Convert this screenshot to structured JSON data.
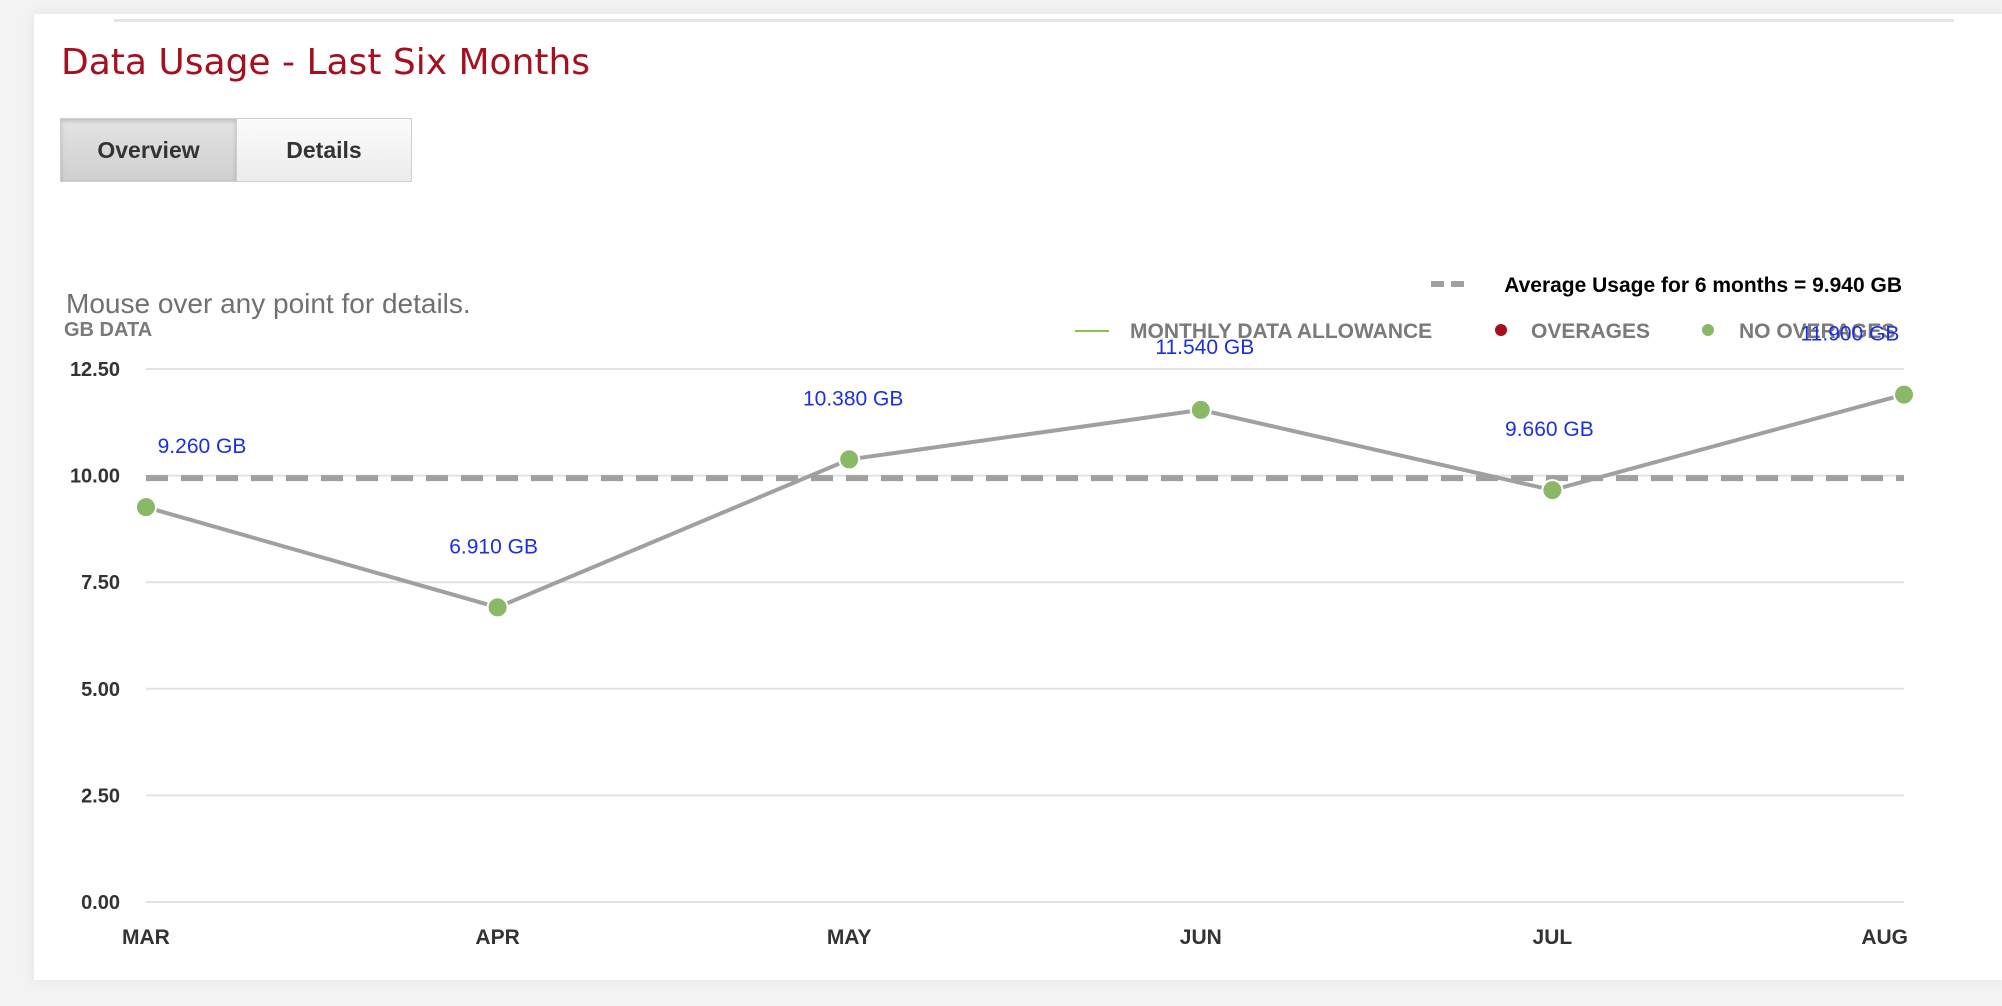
{
  "header": {
    "title": "Data Usage - Last Six Months"
  },
  "tabs": [
    {
      "label": "Overview",
      "active": true
    },
    {
      "label": "Details",
      "active": false
    }
  ],
  "hint": "Mouse over any point for details.",
  "legend": {
    "average_label": "Average Usage for 6 months = 9.940 GB",
    "items": [
      {
        "label": "MONTHLY DATA ALLOWANCE",
        "color": "#8cc152"
      },
      {
        "label": "OVERAGES",
        "color": "#a50f1e"
      },
      {
        "label": "NO OVERAGES",
        "color": "#8ab866"
      }
    ]
  },
  "colors": {
    "title": "#a50f1e",
    "point": "#8ab866",
    "line": "#a0a0a0",
    "average": "#a0a0a0",
    "data_label": "#1a2fe0",
    "grid": "#e2e2e2",
    "axis_text": "#333333"
  },
  "chart_data": {
    "type": "line",
    "ylabel": "GB DATA",
    "categories": [
      "MAR",
      "APR",
      "MAY",
      "JUN",
      "JUL",
      "AUG"
    ],
    "series": [
      {
        "values": [
          9.26,
          6.91,
          10.38,
          11.54,
          9.66,
          11.9
        ],
        "data_labels": [
          "9.260 GB",
          "6.910 GB",
          "10.380 GB",
          "11.540 GB",
          "9.660 GB",
          "11.900 GB"
        ]
      }
    ],
    "average": 9.94,
    "yticks": [
      "12.50",
      "10.00",
      "7.50",
      "5.00",
      "2.50",
      "0.00"
    ],
    "ylim": [
      0,
      12.5
    ],
    "grid": true
  }
}
